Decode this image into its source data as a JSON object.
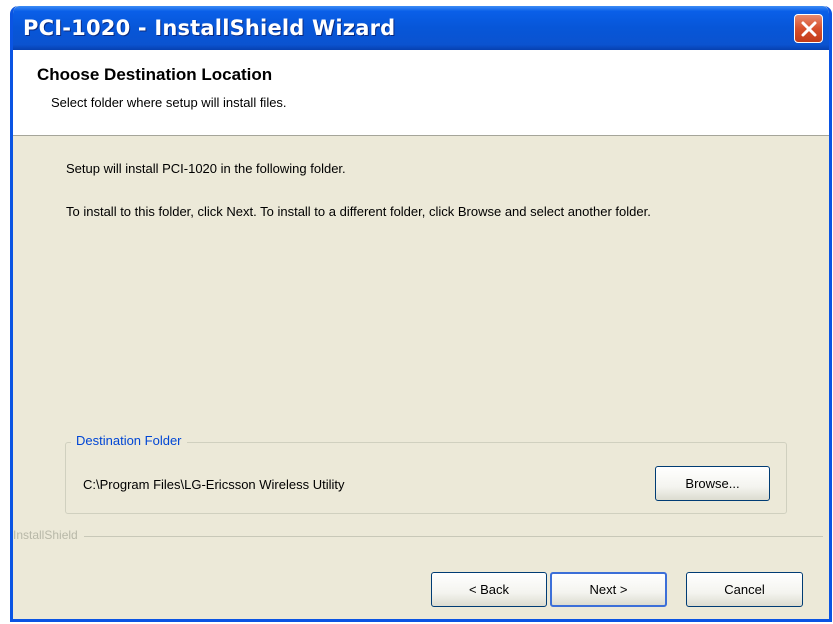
{
  "window": {
    "title": "PCI-1020 - InstallShield Wizard",
    "accent": "#0a54e3",
    "close_icon": "close-icon"
  },
  "header": {
    "title": "Choose Destination Location",
    "subtitle": "Select folder where setup will install files."
  },
  "body": {
    "line1": "Setup will install PCI-1020 in the following folder.",
    "line2": "To install to this folder, click Next. To install to a different folder, click Browse and select another folder."
  },
  "destination": {
    "legend": "Destination Folder",
    "path": "C:\\Program Files\\LG-Ericsson Wireless Utility",
    "browse_label": "Browse..."
  },
  "footer": {
    "brand": "InstallShield",
    "back_label": "< Back",
    "next_label": "Next >",
    "cancel_label": "Cancel"
  }
}
